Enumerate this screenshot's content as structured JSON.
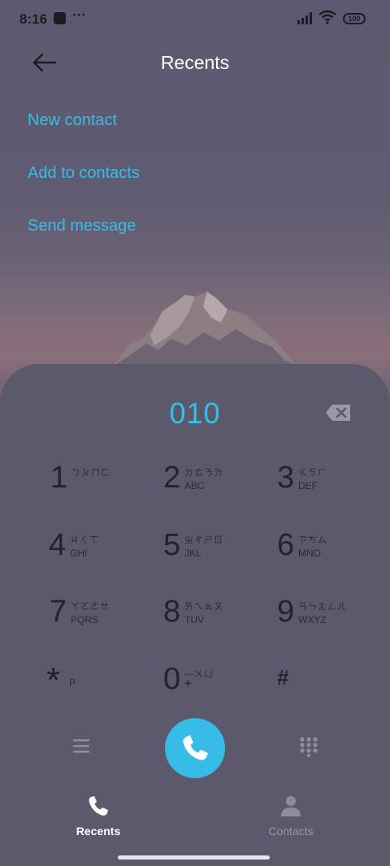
{
  "status_bar": {
    "time": "8:16",
    "dots": "···",
    "battery": "100"
  },
  "header": {
    "title": "Recents"
  },
  "actions": [
    "New contact",
    "Add to contacts",
    "Send message"
  ],
  "dialer": {
    "number": "010",
    "keys": [
      {
        "digit": "1",
        "line1": "ㄅㄆㄇㄈ",
        "line2": ""
      },
      {
        "digit": "2",
        "line1": "ㄉㄊㄋㄌ",
        "line2": "ABC"
      },
      {
        "digit": "3",
        "line1": "ㄍㄎㄏ",
        "line2": "DEF"
      },
      {
        "digit": "4",
        "line1": "ㄐㄑㄒ",
        "line2": "GHI"
      },
      {
        "digit": "5",
        "line1": "ㄓㄔㄕㄖ",
        "line2": "JKL"
      },
      {
        "digit": "6",
        "line1": "ㄗㄘㄙ",
        "line2": "MNO"
      },
      {
        "digit": "7",
        "line1": "ㄚㄛㄜㄝ",
        "line2": "PQRS"
      },
      {
        "digit": "8",
        "line1": "ㄞㄟㄠㄡ",
        "line2": "TUV"
      },
      {
        "digit": "9",
        "line1": "ㄢㄣㄤㄥㄦ",
        "line2": "WXYZ"
      },
      {
        "digit": "*",
        "line1": "",
        "line2": "P"
      },
      {
        "digit": "0",
        "line1": "—ㄨㄩ",
        "line2": "+"
      },
      {
        "digit": "#",
        "line1": "",
        "line2": ""
      }
    ]
  },
  "bottom_nav": {
    "recents": "Recents",
    "contacts": "Contacts"
  },
  "colors": {
    "accent": "#38bde8",
    "sheet": "#5b596b",
    "key_text": "#23232c"
  }
}
